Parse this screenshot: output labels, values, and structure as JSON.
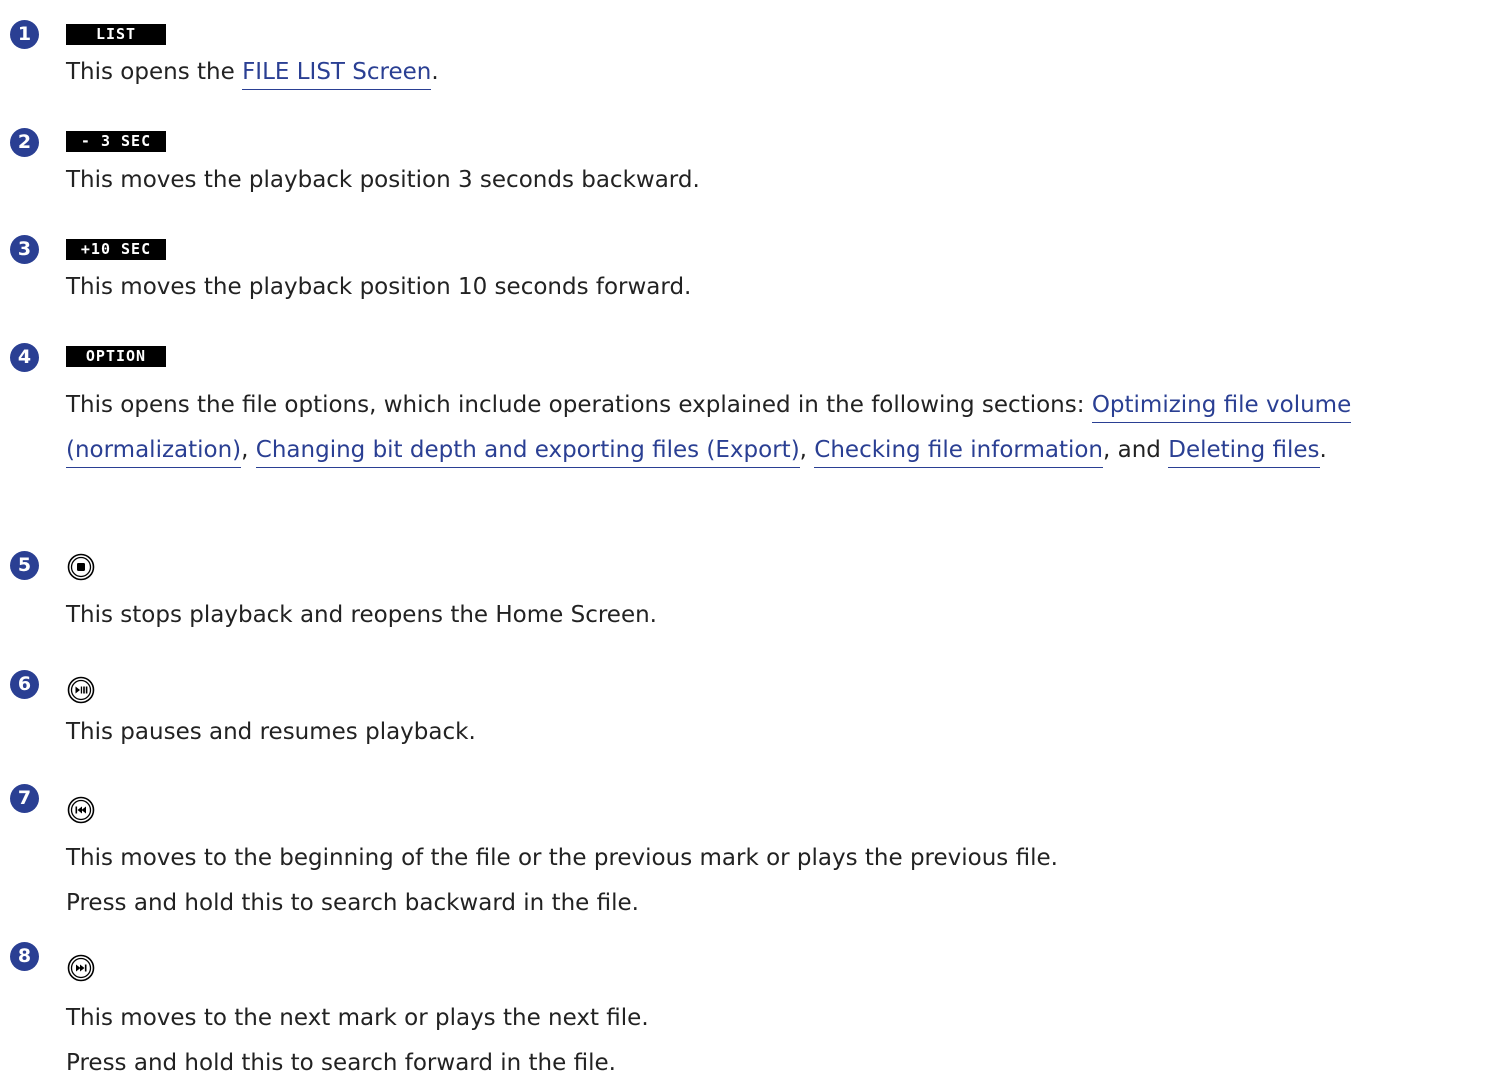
{
  "items": [
    {
      "number": "1",
      "label": "LIST",
      "text_before": "This opens the ",
      "link": "FILE LIST Screen",
      "text_after": "."
    },
    {
      "number": "2",
      "label": "- 3 SEC",
      "text": "This moves the playback position 3 seconds backward."
    },
    {
      "number": "3",
      "label": "+10 SEC",
      "text": "This moves the playback position 10 seconds forward."
    },
    {
      "number": "4",
      "label": "OPTION",
      "text_intro": "This opens the file options, which include operations explained in the following sections: ",
      "links": [
        "Optimizing file volume (normalization)",
        "Changing bit depth and exporting files (Export)",
        "Checking file information",
        "Deleting files"
      ],
      "sep1": ", ",
      "sep2": ", ",
      "sep3": ", and ",
      "text_end": "."
    },
    {
      "number": "5",
      "icon": "stop-button-icon",
      "text": "This stops playback and reopens the Home Screen."
    },
    {
      "number": "6",
      "icon": "play-pause-button-icon",
      "text": "This pauses and resumes playback."
    },
    {
      "number": "7",
      "icon": "rewind-button-icon",
      "lines": [
        "This moves to the beginning of the file or the previous mark or plays the previous file.",
        "Press and hold this to search backward in the file."
      ]
    },
    {
      "number": "8",
      "icon": "fast-forward-button-icon",
      "lines": [
        "This moves to the next mark or plays the next file.",
        "Press and hold this to search forward in the file."
      ]
    }
  ],
  "colors": {
    "accent": "#2a3f93",
    "text": "#222222",
    "label_bg": "#000000"
  }
}
